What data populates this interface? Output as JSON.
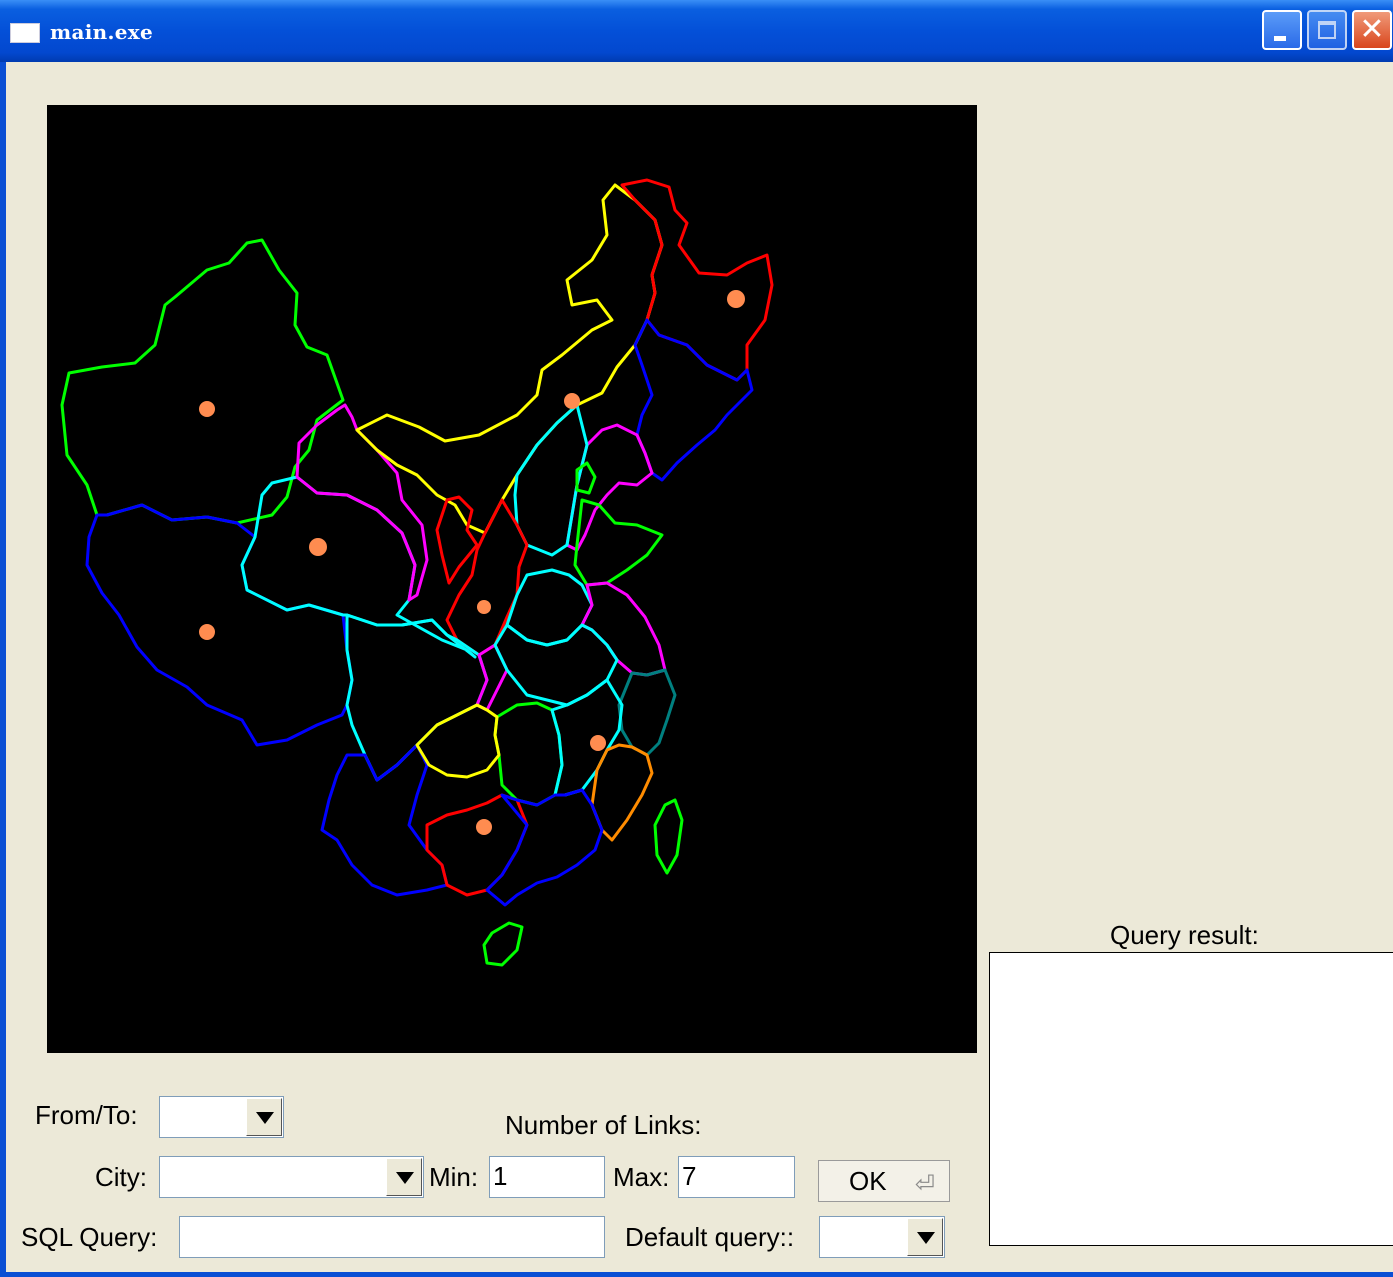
{
  "window": {
    "title": "main.exe",
    "close_glyph": "✕"
  },
  "form": {
    "from_to_label": "From/To:",
    "from_to_value": "",
    "city_label": "City:",
    "city_value": "",
    "sql_label": "SQL Query:",
    "sql_value": "",
    "links_label": "Number of Links:",
    "min_label": "Min:",
    "min_value": "1",
    "max_label": "Max:",
    "max_value": "7",
    "ok_label": "OK",
    "ok_icon": "⏎",
    "default_query_label": "Default query::",
    "default_query_value": ""
  },
  "result": {
    "label": "Query result:",
    "text": ""
  },
  "colors": {
    "map_background": "#000000",
    "marker": "#ff8c50",
    "borders": [
      "#00ff00",
      "#ffff00",
      "#ff0000",
      "#0000ff",
      "#ff00ff",
      "#00ffff",
      "#008080",
      "#ff8c00"
    ]
  }
}
